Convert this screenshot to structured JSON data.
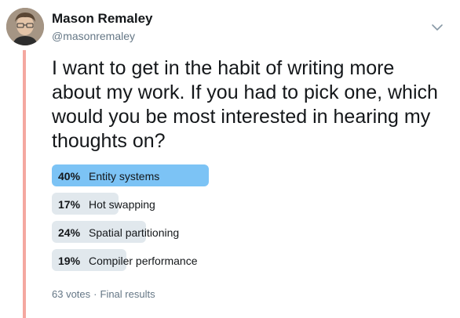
{
  "tweet": {
    "author_name": "Mason Remaley",
    "author_handle": "@masonremaley",
    "text": "I want to get in the habit of writing more about my work. If you had to pick one, which would you be most interested in hearing my thoughts on?",
    "menu_icon": "chevron-down-icon",
    "avatar_icon": "user-avatar"
  },
  "poll": {
    "options": [
      {
        "percent_label": "40%",
        "percent": 40,
        "label": "Entity systems",
        "winner": true
      },
      {
        "percent_label": "17%",
        "percent": 17,
        "label": "Hot swapping",
        "winner": false
      },
      {
        "percent_label": "24%",
        "percent": 24,
        "label": "Spatial partitioning",
        "winner": false
      },
      {
        "percent_label": "19%",
        "percent": 19,
        "label": "Compiler performance",
        "winner": false
      }
    ],
    "votes": "63 votes",
    "separator": "·",
    "status": "Final results"
  },
  "colors": {
    "winner_bar": "#7cc3f5",
    "bar": "#e1e8ed",
    "thread_line": "#f4a8a0",
    "muted_text": "#657786"
  }
}
